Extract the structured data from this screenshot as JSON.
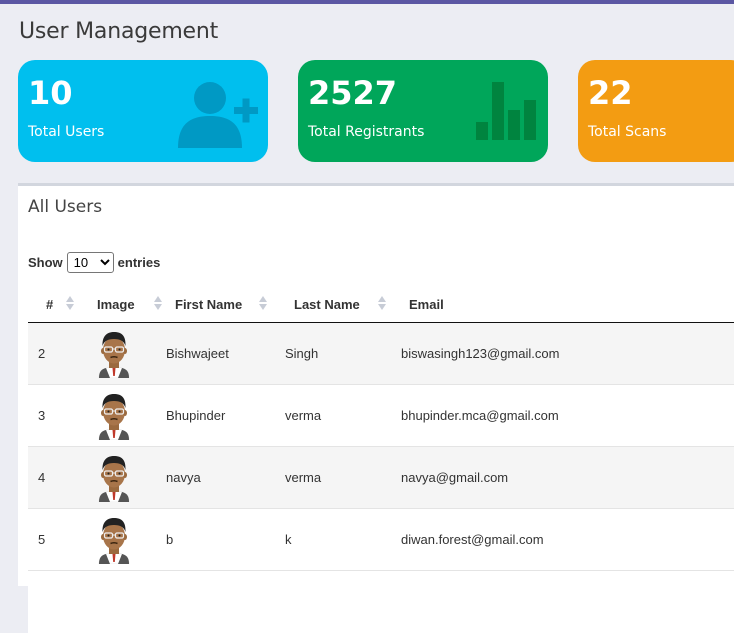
{
  "page": {
    "title": "User Management"
  },
  "cards": [
    {
      "value": "10",
      "label": "Total Users",
      "icon": "user-plus-icon",
      "color": "#00bfee"
    },
    {
      "value": "2527",
      "label": "Total Registrants",
      "icon": "bar-chart-icon",
      "color": "#00a65a"
    },
    {
      "value": "22",
      "label": "Total Scans",
      "icon": "",
      "color": "#f39c12"
    }
  ],
  "panel": {
    "title": "All Users",
    "show_label": "Show",
    "entries_label": "entries",
    "page_size": "10",
    "page_size_options": [
      "10"
    ]
  },
  "table": {
    "headers": {
      "num": "#",
      "image": "Image",
      "first": "First Name",
      "last": "Last Name",
      "email": "Email"
    },
    "rows": [
      {
        "num": "2",
        "first": "Bishwajeet",
        "last": "Singh",
        "email": "biswasingh123@gmail.com"
      },
      {
        "num": "3",
        "first": "Bhupinder",
        "last": "verma",
        "email": "bhupinder.mca@gmail.com"
      },
      {
        "num": "4",
        "first": "navya",
        "last": "verma",
        "email": "navya@gmail.com"
      },
      {
        "num": "5",
        "first": "b",
        "last": "k",
        "email": "diwan.forest@gmail.com"
      }
    ]
  }
}
